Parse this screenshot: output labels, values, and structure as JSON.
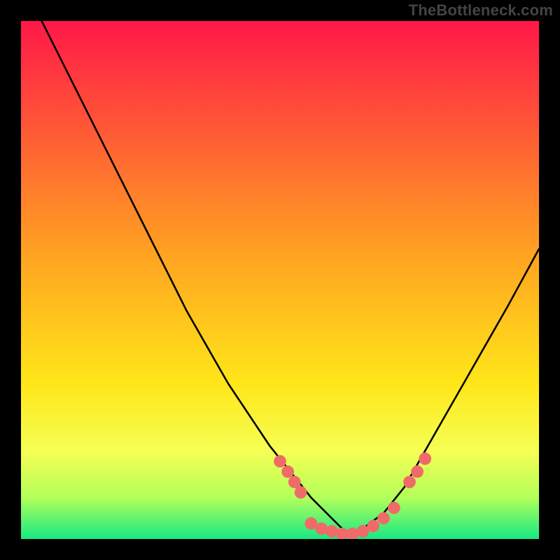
{
  "watermark": "TheBottleneck.com",
  "chart_data": {
    "type": "line",
    "title": "",
    "xlabel": "",
    "ylabel": "",
    "xlim": [
      0,
      100
    ],
    "ylim": [
      0,
      100
    ],
    "grid": false,
    "legend": false,
    "background_gradient_stops": [
      {
        "offset": 0,
        "color": "#ff1848"
      },
      {
        "offset": 45,
        "color": "#ffa321"
      },
      {
        "offset": 70,
        "color": "#ffe619"
      },
      {
        "offset": 83,
        "color": "#f5ff54"
      },
      {
        "offset": 92,
        "color": "#b3ff59"
      },
      {
        "offset": 100,
        "color": "#17e884"
      }
    ],
    "highlight_band": {
      "y0": 80,
      "y1": 100
    },
    "series": [
      {
        "name": "curve",
        "stroke": "#000000",
        "x": [
          4,
          8,
          12,
          16,
          20,
          24,
          28,
          32,
          36,
          40,
          44,
          48,
          52,
          56,
          60,
          62,
          64,
          66,
          70,
          74,
          78,
          82,
          86,
          90,
          94,
          100
        ],
        "y": [
          100,
          92,
          84,
          76,
          68,
          60,
          52,
          44,
          37,
          30,
          24,
          18,
          13,
          8,
          4,
          2,
          1,
          2,
          5,
          10,
          17,
          24,
          31,
          38,
          45,
          56
        ]
      }
    ],
    "markers": {
      "name": "dots",
      "color": "#f06a6a",
      "radius": 1.2,
      "points": [
        {
          "x": 50,
          "y": 15
        },
        {
          "x": 51.5,
          "y": 13
        },
        {
          "x": 52.8,
          "y": 11
        },
        {
          "x": 54,
          "y": 9
        },
        {
          "x": 56,
          "y": 3
        },
        {
          "x": 58,
          "y": 2
        },
        {
          "x": 60,
          "y": 1.5
        },
        {
          "x": 62,
          "y": 1
        },
        {
          "x": 64,
          "y": 1
        },
        {
          "x": 66,
          "y": 1.5
        },
        {
          "x": 68,
          "y": 2.5
        },
        {
          "x": 70,
          "y": 4
        },
        {
          "x": 72,
          "y": 6
        },
        {
          "x": 75,
          "y": 11
        },
        {
          "x": 76.5,
          "y": 13
        },
        {
          "x": 78,
          "y": 15.5
        }
      ]
    }
  }
}
